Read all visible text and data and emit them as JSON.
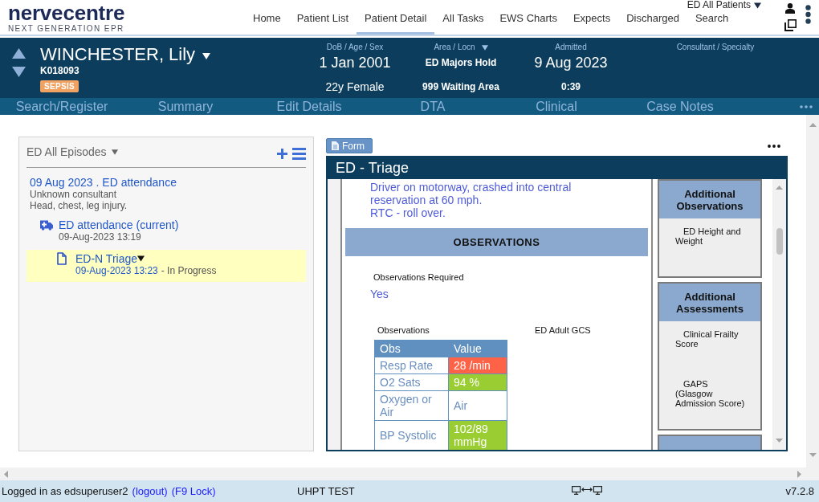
{
  "header": {
    "logo": {
      "wordmark": "nervecentre",
      "tagline": "NEXT GENERATION EPR"
    },
    "list_selector": "ED All Patients",
    "nav": [
      {
        "label": "Home",
        "selected": false
      },
      {
        "label": "Patient List",
        "selected": false
      },
      {
        "label": "Patient Detail",
        "selected": true
      },
      {
        "label": "All Tasks",
        "selected": false
      },
      {
        "label": "EWS Charts",
        "selected": false
      },
      {
        "label": "Expects",
        "selected": false
      },
      {
        "label": "Discharged",
        "selected": false
      },
      {
        "label": "Search",
        "selected": false
      }
    ]
  },
  "patient": {
    "name": "WINCHESTER, Lily",
    "number": "K018093",
    "alerts": [
      "SEPSIS"
    ],
    "columns": [
      {
        "label": "DoB / Age / Sex",
        "dropdown": false,
        "values": [
          {
            "text": "1 Jan 2001",
            "kind": "large"
          },
          {
            "text": "22y Female",
            "kind": "plain"
          }
        ]
      },
      {
        "label": "Area / Locn",
        "dropdown": true,
        "values": [
          {
            "text": "ED Majors Hold",
            "kind": "bold"
          },
          {
            "text": "999 Waiting Area",
            "kind": "bold"
          }
        ]
      },
      {
        "label": "Admitted",
        "dropdown": false,
        "values": [
          {
            "text": "9 Aug 2023",
            "kind": "large"
          },
          {
            "text": "0:39",
            "kind": "bold"
          }
        ]
      },
      {
        "label": "Consultant / Specialty",
        "dropdown": false
      }
    ]
  },
  "subnav": [
    "Search/Register",
    "Summary",
    "Edit Details",
    "DTA",
    "Clinical",
    "Case Notes"
  ],
  "episodes": {
    "title": "ED All Episodes",
    "items": [
      {
        "title": "09 Aug 2023 . ED attendance",
        "lines": [
          "Unknown consultant",
          "Head, chest, leg injury."
        ],
        "selected": false,
        "children": [
          {
            "kind": "attendance",
            "title": "ED attendance (current)",
            "lines": [
              "09-Aug-2023 13:19"
            ],
            "selected": false,
            "children": [
              {
                "kind": "form",
                "title": "ED-N Triage",
                "lines": [
                  "09-Aug-2023 13:23"
                ],
                "status": "- In Progress",
                "selected": true
              }
            ]
          }
        ]
      }
    ]
  },
  "form": {
    "button": "Form",
    "title": "ED - Triage",
    "narrative": "Driver on motorway, crashed into central reservation at 60 mph.\nRTC - roll over.",
    "section": "OBSERVATIONS",
    "fields": [
      {
        "label": "Observations Required",
        "value": "Yes"
      }
    ],
    "observations": {
      "caption": "Observations",
      "columns": [
        "Obs",
        "Value"
      ],
      "rows": [
        {
          "name": "Resp Rate",
          "value": "28 /min",
          "color": "#ff6347"
        },
        {
          "name": "O2 Sats",
          "value": "94 %",
          "color": "#9acd32"
        },
        {
          "name": "Oxygen or Air",
          "value": "Air"
        },
        {
          "name": "BP Systolic",
          "value": "102/89 mmHg",
          "color": "#9acd32"
        }
      ]
    },
    "gcs_caption": "ED Adult GCS",
    "side_panels": [
      {
        "title": "Additional Observations",
        "links": [
          "ED Height and Weight"
        ]
      },
      {
        "title": "Additional Assessments",
        "links": [
          "Clinical Frailty Score",
          "GAPS (Glasgow Admission Score)"
        ]
      }
    ]
  },
  "status_bar": {
    "user": "Logged in as edsuperuser2",
    "links": [
      "(logout)",
      "(F9 Lock)"
    ],
    "environment": "UHPT TEST",
    "version": "v7.2.8"
  }
}
